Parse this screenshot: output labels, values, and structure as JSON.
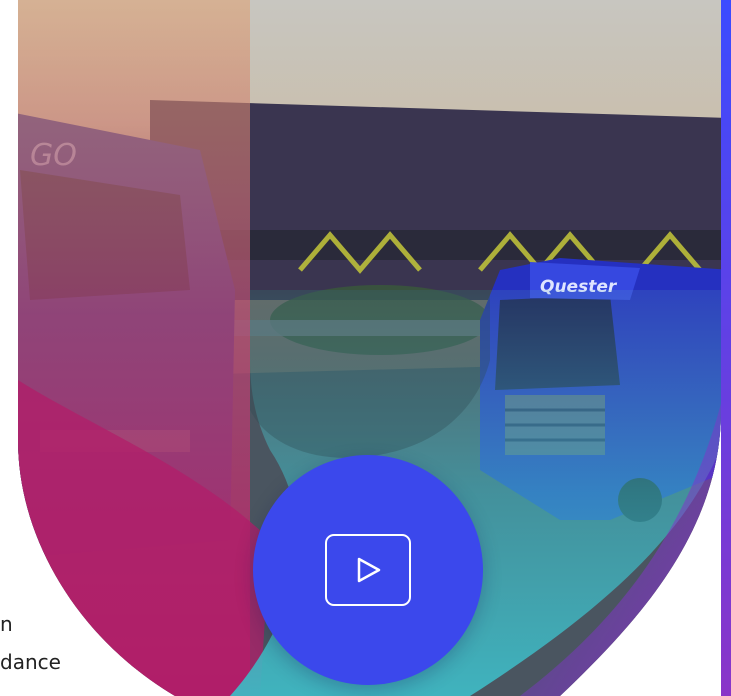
{
  "hero": {
    "truck_badge_right": "Quester",
    "truck_badge_left": "GO"
  },
  "side_text": {
    "line1": "n",
    "line2": "dance"
  },
  "video": {
    "play_icon": "play-icon"
  },
  "colors": {
    "accent_blue": "#3b48ec",
    "magenta": "#b21e6a",
    "teal": "#3fb8c3",
    "purple": "#7a3bd4"
  }
}
